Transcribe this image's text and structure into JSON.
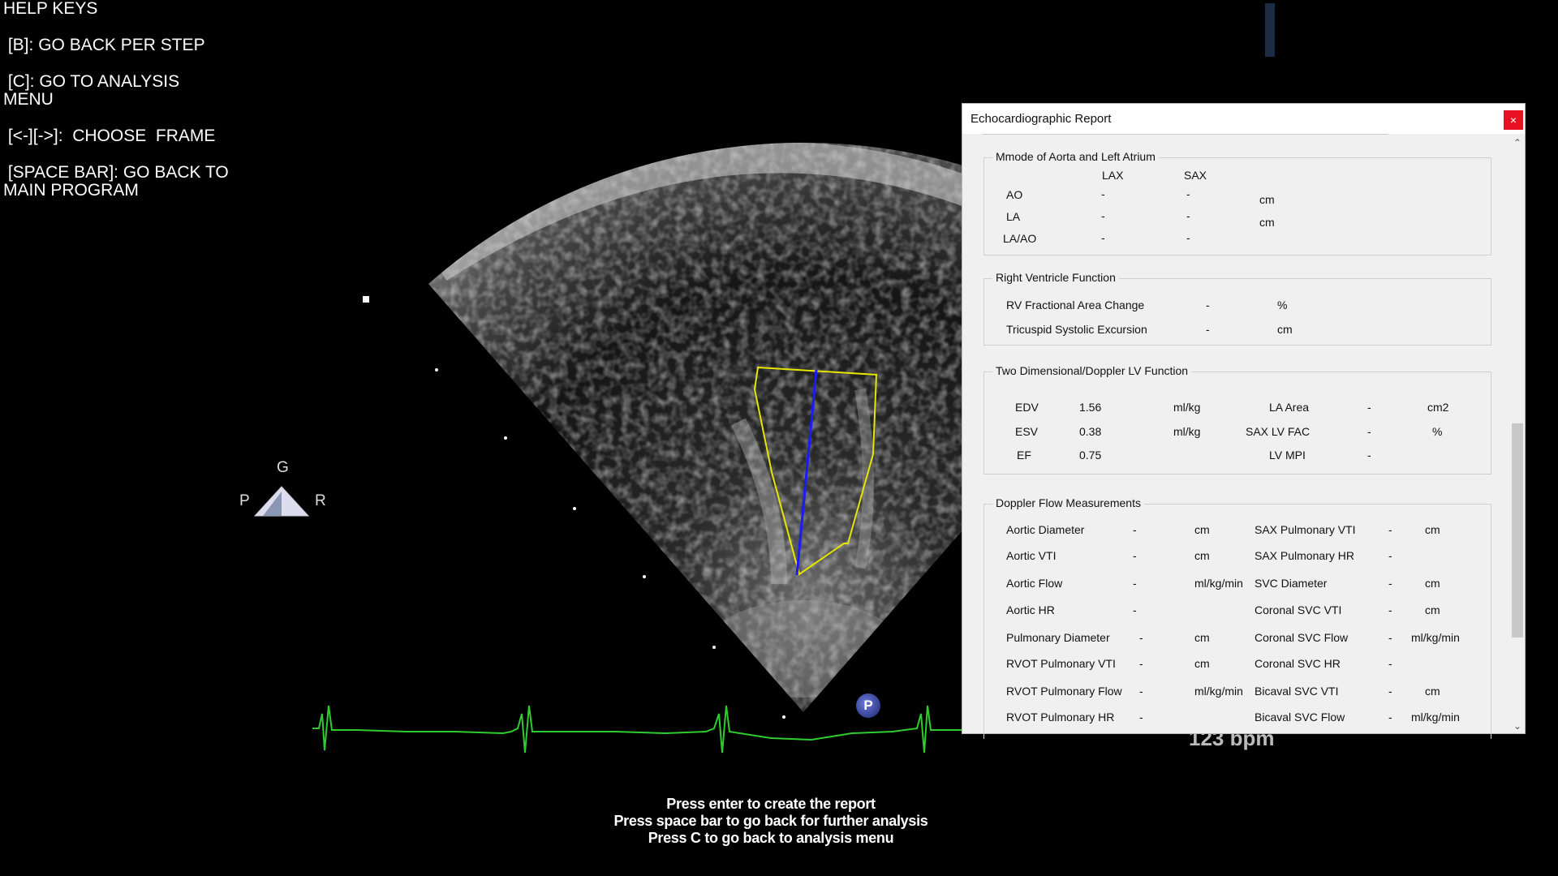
{
  "help_keys": {
    "lines": [
      "HELP KEYS",
      " [B]: GO BACK PER STEP",
      " [C]: GO TO ANALYSIS\nMENU",
      " [<-][->]:  CHOOSE  FRAME",
      " [SPACE BAR]: GO BACK TO\nMAIN PROGRAM"
    ]
  },
  "orientation": {
    "top": "G",
    "left": "P",
    "right": "R"
  },
  "probe_marker": "P",
  "heart_rate": "123 bpm",
  "instructions": [
    "Press enter to create the report",
    "Press space bar to go back for further analysis",
    "Press C to go back to analysis menu"
  ],
  "colors": {
    "ecg": "#2ecc2e",
    "contour": "#e6e600",
    "axis_line": "#1a1aff",
    "close_button": "#e81123"
  },
  "report": {
    "title": "Echocardiographic Report",
    "close_icon": "×",
    "mmode": {
      "legend": "Mmode of Aorta and Left Atrium",
      "col_lax": "LAX",
      "col_sax": "SAX",
      "rows": [
        {
          "label": "AO",
          "lax": "-",
          "sax": "-",
          "unit": "cm"
        },
        {
          "label": "LA",
          "lax": "-",
          "sax": "-",
          "unit": "cm"
        },
        {
          "label": "LA/AO",
          "lax": "-",
          "sax": "-",
          "unit": ""
        }
      ]
    },
    "rv": {
      "legend": "Right Ventricle Function",
      "rows": [
        {
          "label": "RV Fractional Area Change",
          "value": "-",
          "unit": "%"
        },
        {
          "label": "Tricuspid Systolic Excursion",
          "value": "-",
          "unit": "cm"
        }
      ]
    },
    "lv": {
      "legend": "Two Dimensional/Doppler LV Function",
      "left": [
        {
          "label": "EDV",
          "value": "1.56",
          "unit": "ml/kg"
        },
        {
          "label": "ESV",
          "value": "0.38",
          "unit": "ml/kg"
        },
        {
          "label": "EF",
          "value": "0.75",
          "unit": ""
        }
      ],
      "right": [
        {
          "label": "LA Area",
          "value": "-",
          "unit": "cm2"
        },
        {
          "label": "SAX LV FAC",
          "value": "-",
          "unit": "%"
        },
        {
          "label": "LV MPI",
          "value": "-",
          "unit": ""
        }
      ]
    },
    "doppler": {
      "legend": "Doppler Flow Measurements",
      "left": [
        {
          "label": "Aortic Diameter",
          "value": "-",
          "unit": "cm"
        },
        {
          "label": "Aortic VTI",
          "value": "-",
          "unit": "cm"
        },
        {
          "label": "Aortic Flow",
          "value": "-",
          "unit": "ml/kg/min"
        },
        {
          "label": "Aortic HR",
          "value": "-",
          "unit": ""
        },
        {
          "label": "Pulmonary Diameter",
          "value": "-",
          "unit": "cm"
        },
        {
          "label": "RVOT Pulmonary VTI",
          "value": "-",
          "unit": "cm"
        },
        {
          "label": "RVOT Pulmonary Flow",
          "value": "-",
          "unit": "ml/kg/min"
        },
        {
          "label": "RVOT Pulmonary HR",
          "value": "-",
          "unit": ""
        }
      ],
      "right": [
        {
          "label": "SAX Pulmonary VTI",
          "value": "-",
          "unit": "cm"
        },
        {
          "label": "SAX Pulmonary HR",
          "value": "-",
          "unit": ""
        },
        {
          "label": "SVC Diameter",
          "value": "-",
          "unit": "cm"
        },
        {
          "label": "Coronal SVC VTI",
          "value": "-",
          "unit": "cm"
        },
        {
          "label": "Coronal SVC Flow",
          "value": "-",
          "unit": "ml/kg/min"
        },
        {
          "label": "Coronal SVC HR",
          "value": "-",
          "unit": ""
        },
        {
          "label": "Bicaval SVC VTI",
          "value": "-",
          "unit": "cm"
        },
        {
          "label": "Bicaval SVC Flow",
          "value": "-",
          "unit": "ml/kg/min"
        }
      ]
    }
  }
}
